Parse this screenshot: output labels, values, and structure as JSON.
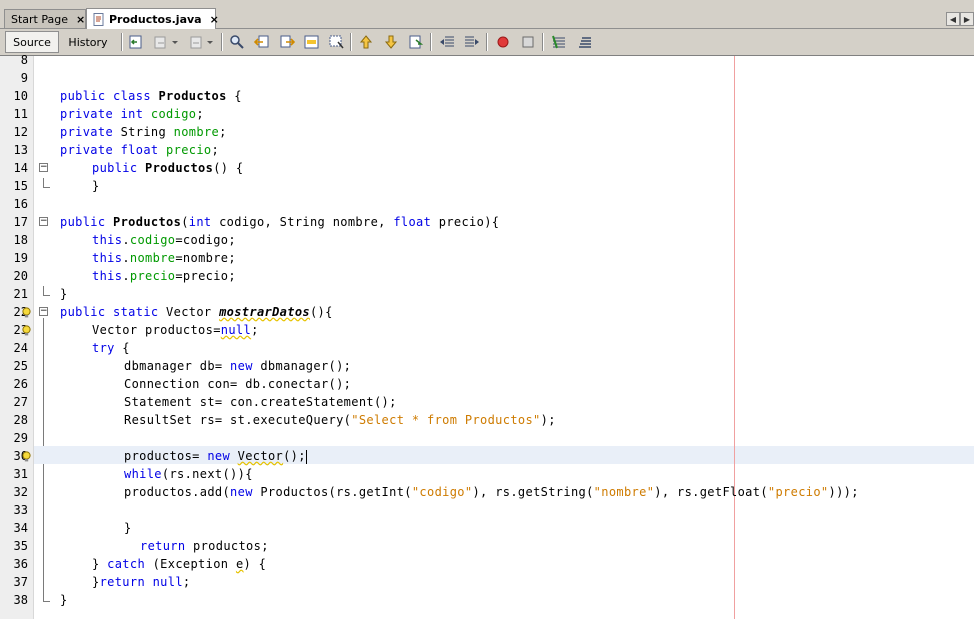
{
  "tabs": [
    {
      "label": "Start Page",
      "close": "×",
      "active": false
    },
    {
      "label": "Productos.java",
      "close": "×",
      "active": true
    }
  ],
  "toolbar": {
    "source_label": "Source",
    "history_label": "History",
    "icons": [
      "back-icon",
      "forward-icon",
      "navigate-icon",
      "find-icon",
      "find-previous-icon",
      "find-next-icon",
      "toggle-highlight-icon",
      "find-selection-icon",
      "previous-bookmark-icon",
      "next-bookmark-icon",
      "toggle-bookmark-icon",
      "shift-left-icon",
      "shift-right-icon",
      "start-macro-icon",
      "stop-macro-icon",
      "comment-icon",
      "uncomment-icon"
    ]
  },
  "editor": {
    "line_numbers": [
      "8",
      "9",
      "10",
      "11",
      "12",
      "13",
      "14",
      "15",
      "16",
      "17",
      "18",
      "19",
      "20",
      "21",
      "22",
      "23",
      "24",
      "25",
      "26",
      "27",
      "28",
      "29",
      "30",
      "31",
      "32",
      "33",
      "34",
      "35",
      "36",
      "37",
      "38"
    ],
    "code_text": {
      "l10_kw": "public class ",
      "l10_name": "Productos",
      "l10_rest": " {",
      "l11_kw": "private int ",
      "l11_f": "codigo",
      "l11_rest": ";",
      "l12_kw": "private ",
      "l12_t": "String ",
      "l12_f": "nombre",
      "l12_rest": ";",
      "l13_kw": "private float ",
      "l13_f": "precio",
      "l13_rest": ";",
      "l14_kw": "public ",
      "l14_name": "Productos",
      "l14_rest": "() {",
      "l15": "}",
      "l17_kw": "public ",
      "l17_name": "Productos",
      "l17_a": "(",
      "l17_kw2": "int",
      "l17_b": " codigo, String nombre, ",
      "l17_kw3": "float",
      "l17_c": " precio){",
      "l18_kw": "this",
      "l18_dot": ".",
      "l18_f": "codigo",
      "l18_rest": "=codigo;",
      "l19_kw": "this",
      "l19_dot": ".",
      "l19_f": "nombre",
      "l19_rest": "=nombre;",
      "l20_kw": "this",
      "l20_dot": ".",
      "l20_f": "precio",
      "l20_rest": "=precio;",
      "l21": "}",
      "l22_kw": "public static ",
      "l22_t": "Vector ",
      "l22_name": "mostrarDatos",
      "l22_rest": "(){",
      "l23_a": "Vector productos=",
      "l23_kw": "null",
      "l23_rest": ";",
      "l24_kw": "try",
      "l24_rest": " {",
      "l25_a": "dbmanager db= ",
      "l25_kw": "new",
      "l25_rest": " dbmanager();",
      "l26": "Connection con= db.conectar();",
      "l27": "Statement st= con.createStatement();",
      "l28_a": "ResultSet rs= st.executeQuery(",
      "l28_str": "\"Select * from Productos\"",
      "l28_rest": ");",
      "l30_a": "productos= ",
      "l30_kw": "new",
      "l30_b": " ",
      "l30_t": "Vector",
      "l30_rest": "();",
      "l31_kw": "while",
      "l31_rest": "(rs.next()){",
      "l32_a": "productos.add(",
      "l32_kw": "new",
      "l32_b": " Productos(rs.getInt(",
      "l32_s1": "\"codigo\"",
      "l32_c": "), rs.getString(",
      "l32_s2": "\"nombre\"",
      "l32_d": "), rs.getFloat(",
      "l32_s3": "\"precio\"",
      "l32_e": ")));",
      "l34": "}",
      "l35_kw": "return",
      "l35_rest": " productos;",
      "l36_a": "} ",
      "l36_kw": "catch",
      "l36_b": " (Exception ",
      "l36_e": "e",
      "l36_rest": ") {",
      "l37_a": "}",
      "l37_kw": "return null",
      "l37_rest": ";",
      "l38": "}"
    },
    "colors": {
      "keyword": "#0000e6",
      "field": "#009900",
      "string": "#ce7b00",
      "current_line": "#e9eff8",
      "margin_line": "#f0a0a0"
    }
  }
}
